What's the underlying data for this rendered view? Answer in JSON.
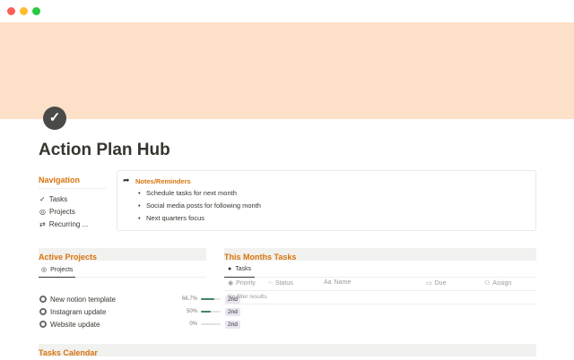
{
  "window": {
    "controls": {
      "close": "#ff5f57",
      "minimize": "#febc2e",
      "maximize": "#28c840"
    }
  },
  "cover": {
    "color": "#fde0c8"
  },
  "page": {
    "icon": "check-circle-icon",
    "title": "Action Plan Hub"
  },
  "navigation": {
    "heading": "Navigation",
    "items": [
      {
        "label": "Tasks",
        "icon": "checkmark-icon"
      },
      {
        "label": "Projects",
        "icon": "target-icon"
      },
      {
        "label": "Recurring ...",
        "icon": "repeat-icon"
      }
    ]
  },
  "notes": {
    "heading": "Notes/Reminders",
    "icon": "share-arrow-icon",
    "items": [
      "Schedule tasks for next month",
      "Social media posts for following month",
      "Next quarters focus"
    ]
  },
  "active_projects": {
    "heading": "Active Projects",
    "tab": "Projects",
    "rows": [
      {
        "name": "New notion template",
        "progress_label": "66.7%",
        "progress": 66.7,
        "tag": "2nd"
      },
      {
        "name": "Instagram update",
        "progress_label": "50%",
        "progress": 50,
        "tag": "2nd"
      },
      {
        "name": "Website update",
        "progress_label": "0%",
        "progress": 0,
        "tag": "2nd"
      }
    ]
  },
  "month_tasks": {
    "heading": "This Months Tasks",
    "tab": "Tasks",
    "columns": [
      "Priority",
      "Status",
      "Name",
      "Due",
      "Assign"
    ],
    "empty": "No filter results."
  },
  "calendar": {
    "heading": "Tasks Calendar"
  },
  "accent": "#d9730d"
}
